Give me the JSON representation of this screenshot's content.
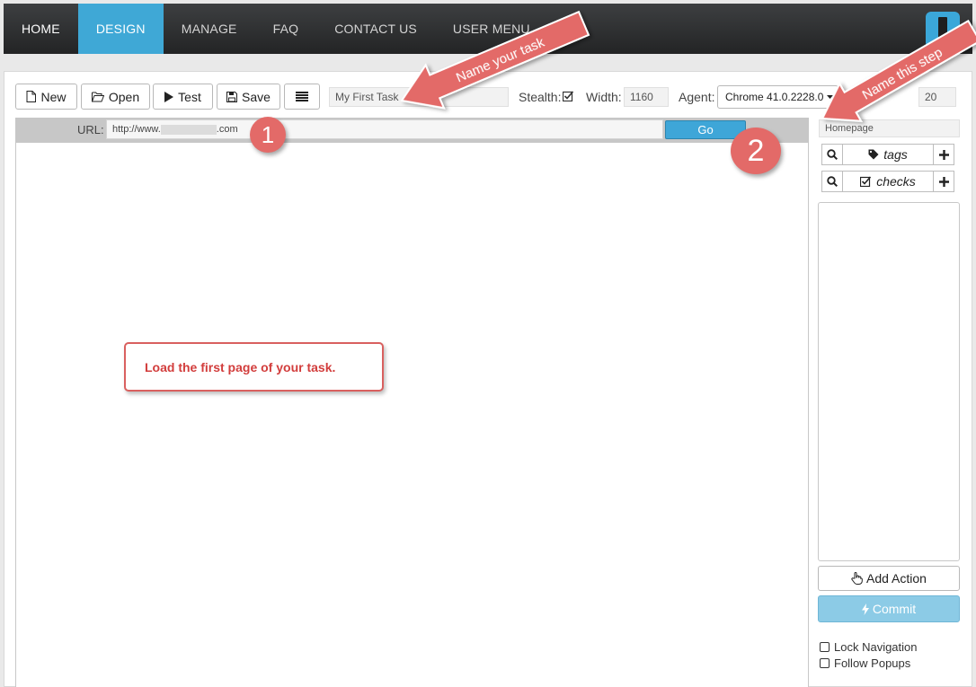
{
  "nav": {
    "items": [
      "HOME",
      "DESIGN",
      "MANAGE",
      "FAQ",
      "CONTACT US",
      "USER MENU"
    ],
    "active": "DESIGN"
  },
  "toolbar": {
    "new_label": "New",
    "open_label": "Open",
    "test_label": "Test",
    "save_label": "Save",
    "task_name": "My First Task",
    "stealth_label": "Stealth:",
    "stealth_checked": true,
    "width_label": "Width:",
    "width_value": "1160",
    "agent_label": "Agent:",
    "agent_value": "Chrome 41.0.2228.0",
    "timeout_value": "20"
  },
  "browser": {
    "url_label": "URL:",
    "url_prefix": "http://www.",
    "url_suffix": ".com",
    "go_label": "Go"
  },
  "annotations": {
    "arrow_task": "Name your task",
    "arrow_step": "Name this step",
    "badge_1": "1",
    "badge_2": "2",
    "callout": "Load the first page of your task."
  },
  "sidepanel": {
    "step_name": "Homepage",
    "tags_label": "tags",
    "checks_label": "checks",
    "add_action_label": "Add Action",
    "commit_label": "Commit",
    "lock_navigation_label": "Lock Navigation",
    "follow_popups_label": "Follow Popups"
  },
  "colors": {
    "accent": "#3fa8d6",
    "annotation": "#e36a68",
    "nav_bg": "#2e2f31"
  }
}
